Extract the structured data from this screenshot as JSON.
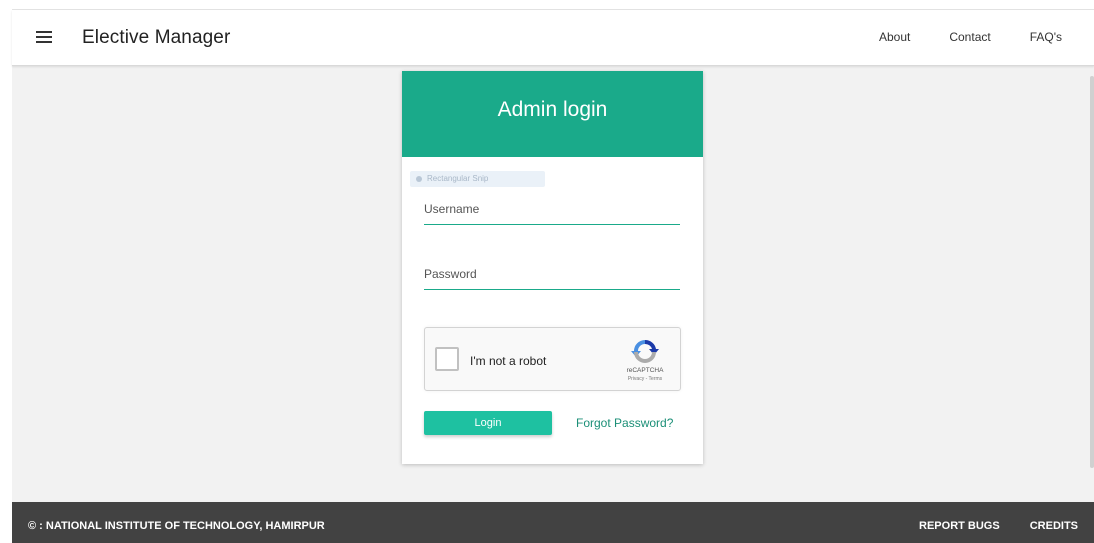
{
  "navbar": {
    "menu_icon": "hamburger-menu-icon",
    "brand": "Elective Manager",
    "links": [
      "About",
      "Contact",
      "FAQ's"
    ]
  },
  "card": {
    "title": "Admin login",
    "snip_overlay": "Rectangular Snip",
    "username_placeholder": "Username",
    "password_placeholder": "Password",
    "recaptcha": {
      "label": "I'm not a robot",
      "brand": "reCAPTCHA",
      "terms": "Privacy - Terms",
      "logo_icon": "recaptcha-logo-icon"
    },
    "login_label": "Login",
    "forgot_label": "Forgot Password?"
  },
  "footer": {
    "copyright": "© : NATIONAL INSTITUTE OF TECHNOLOGY, HAMIRPUR",
    "links": [
      "REPORT BUGS",
      "CREDITS"
    ]
  },
  "colors": {
    "accent": "#1aaa8a",
    "button": "#1ec1a1",
    "footer_bg": "#424242",
    "page_bg": "#f2f2f2"
  }
}
